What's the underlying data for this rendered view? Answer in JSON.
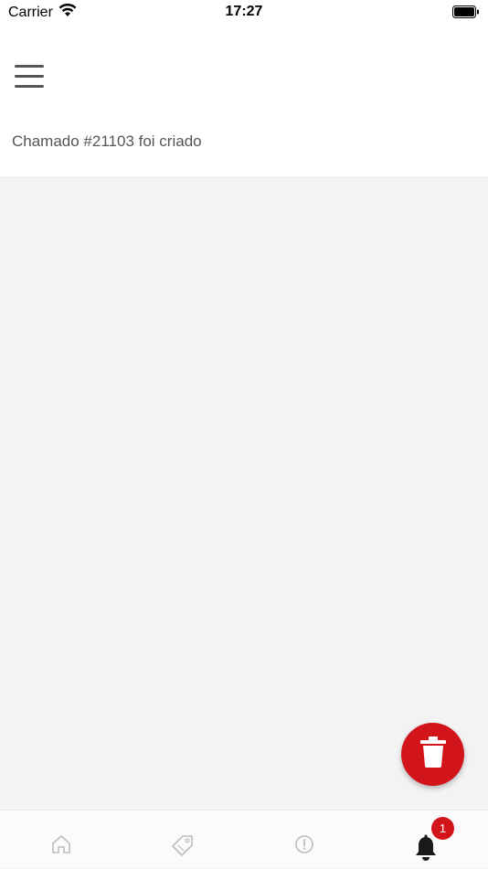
{
  "status_bar": {
    "carrier": "Carrier",
    "time": "17:27"
  },
  "header": {
    "menu_icon": "hamburger-menu-icon"
  },
  "notifications": [
    {
      "text": "Chamado #21103 foi criado"
    }
  ],
  "fab": {
    "icon": "trash-icon",
    "color": "#d2141b"
  },
  "tab_bar": {
    "tabs": [
      {
        "icon": "home-icon",
        "active": false
      },
      {
        "icon": "tag-icon",
        "active": false
      },
      {
        "icon": "alert-circle-icon",
        "active": false
      },
      {
        "icon": "bell-icon",
        "active": true,
        "badge": "1"
      }
    ]
  },
  "colors": {
    "accent": "#d2141b",
    "background": "#f3f3f3",
    "text": "#555555",
    "inactive_icon": "#bdbdbd"
  }
}
